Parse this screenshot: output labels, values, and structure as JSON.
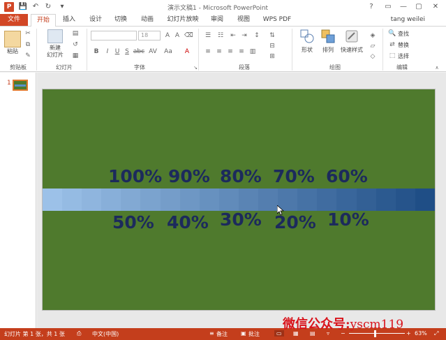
{
  "window": {
    "title": "演示文稿1 - Microsoft PowerPoint",
    "controls": [
      "?",
      "▭",
      "—",
      "▢",
      "✕"
    ]
  },
  "quick_access": {
    "save_icon": "💾",
    "undo_icon": "↶",
    "redo_icon": "↻",
    "custom_icon": "▾"
  },
  "tabs": [
    {
      "label": "文件"
    },
    {
      "label": "开始"
    },
    {
      "label": "插入"
    },
    {
      "label": "设计"
    },
    {
      "label": "切换"
    },
    {
      "label": "动画"
    },
    {
      "label": "幻灯片放映"
    },
    {
      "label": "审阅"
    },
    {
      "label": "视图"
    },
    {
      "label": "WPS PDF"
    }
  ],
  "user": {
    "name": "tang weilei"
  },
  "ribbon": {
    "clipboard": {
      "paste_label": "粘贴",
      "group_label": "剪贴板"
    },
    "slides": {
      "new_slide_label": "新建\n幻灯片",
      "group_label": "幻灯片"
    },
    "font": {
      "font_size_value": "18",
      "group_label": "字体",
      "buttons": [
        "B",
        "I",
        "U",
        "S",
        "abc",
        "AV",
        "Aa",
        "A"
      ]
    },
    "paragraph": {
      "group_label": "段落"
    },
    "drawing": {
      "shape_label": "形状",
      "arrange_label": "排列",
      "quickstyle_label": "快速样式",
      "group_label": "绘图"
    },
    "editing": {
      "find_label": "查找",
      "replace_label": "替换",
      "select_label": "选择",
      "group_label": "编辑"
    }
  },
  "slide_pane": {
    "slide_number": "1"
  },
  "slide": {
    "top_labels": [
      "100%",
      "90%",
      "80%",
      "70%",
      "60%"
    ],
    "bottom_labels": [
      "50%",
      "40%",
      "30%",
      "20%",
      "10%"
    ],
    "gradient_from": "#9cc1e8",
    "gradient_to": "#1f4e86",
    "background": "#4f7a2d",
    "label_color": "#1c2a5c"
  },
  "statusbar": {
    "slide_info": "幻灯片 第 1 张，共 1 张",
    "language": "中文(中国)",
    "notes_label": "备注",
    "comments_label": "批注",
    "zoom": "63%"
  },
  "watermark": {
    "cn": "微信公众号:",
    "en": "yscm119"
  },
  "colors": {
    "accent": "#c43e1c",
    "file_tab": "#d24726"
  }
}
